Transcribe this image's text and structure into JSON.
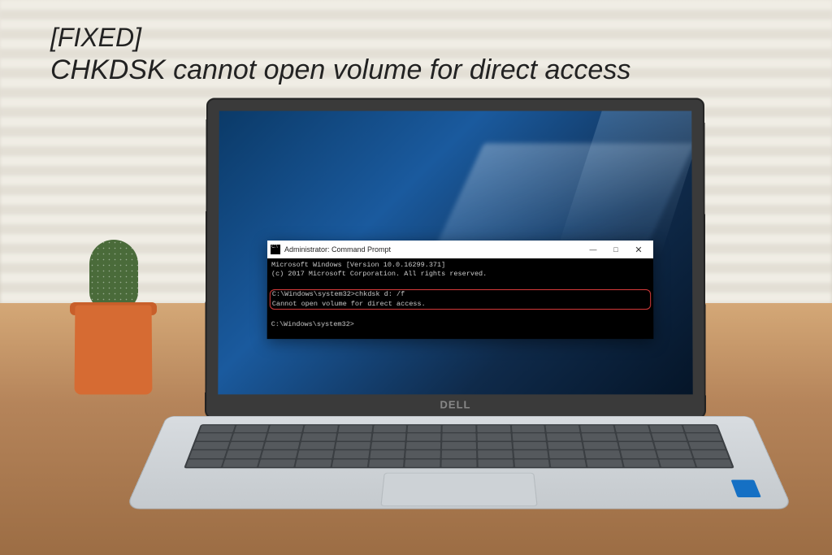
{
  "headline": {
    "tag": "[FIXED]",
    "title": "CHKDSK cannot open volume for direct access"
  },
  "laptop": {
    "brand": "DELL"
  },
  "cmd": {
    "window_title": "Administrator: Command Prompt",
    "minimize": "—",
    "maximize": "□",
    "close": "✕",
    "line1": "Microsoft Windows [Version 10.0.16299.371]",
    "line2": "(c) 2017 Microsoft Corporation. All rights reserved.",
    "blank1": " ",
    "prompt_cmd": "C:\\Windows\\system32>chkdsk d: /f",
    "error": "Cannot open volume for direct access.",
    "blank2": " ",
    "prompt_idle": "C:\\Windows\\system32>"
  }
}
